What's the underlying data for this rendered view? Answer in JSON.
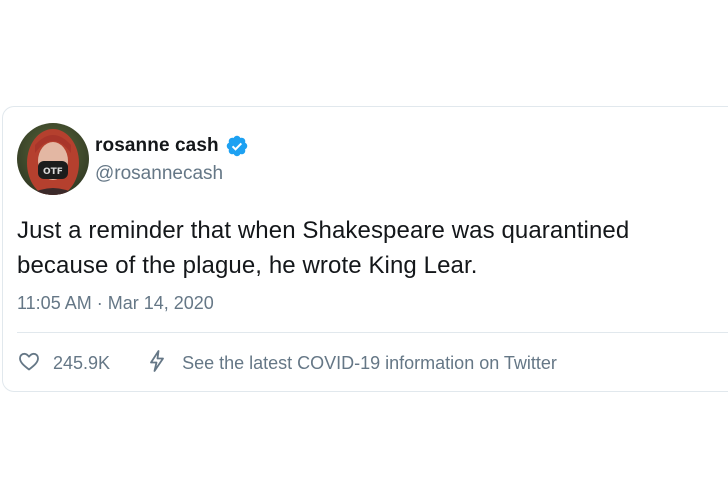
{
  "tweet": {
    "display_name": "rosanne cash",
    "handle": "@rosannecash",
    "avatar_icon": "profile-photo-avatar",
    "avatar_mask_text": "OTF",
    "verified_icon": "verified-badge-icon",
    "verified_color": "#1da1f2",
    "text": "Just a reminder that when Shakespeare was quarantined because of the plague, he wrote King Lear.",
    "timestamp": "11:05 AM · Mar 14, 2020",
    "like_count": "245.9K",
    "like_icon": "heart-icon",
    "info_icon": "lightning-bolt-icon",
    "info_link": "See the latest COVID-19 information on Twitter"
  },
  "colors": {
    "text_primary": "#14171a",
    "text_secondary": "#657786",
    "border": "#e1e8ed",
    "accent": "#1da1f2"
  }
}
